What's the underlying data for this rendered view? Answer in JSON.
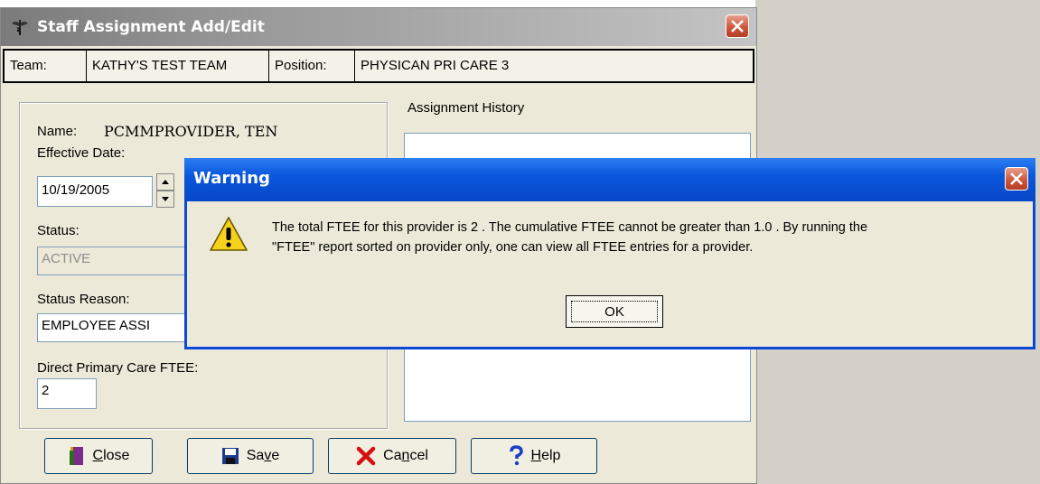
{
  "window": {
    "title": "Staff Assignment Add/Edit",
    "team_label": "Team:",
    "team_value": "KATHY'S TEST TEAM",
    "position_label": "Position:",
    "position_value": "PHYSICAN PRI CARE 3"
  },
  "form": {
    "name_label": "Name:",
    "name_value": "PCMMPROVIDER, TEN",
    "effective_date_label": "Effective Date:",
    "effective_date_value": "10/19/2005",
    "status_label": "Status:",
    "status_value": "ACTIVE",
    "status_reason_label": "Status Reason:",
    "status_reason_value": "EMPLOYEE ASSI",
    "ftee_label": "Direct Primary Care FTEE:",
    "ftee_value": "2"
  },
  "history": {
    "label": "Assignment History"
  },
  "buttons": {
    "close": {
      "pre": "",
      "u": "C",
      "post": "lose"
    },
    "save": {
      "pre": "Sa",
      "u": "v",
      "post": "e"
    },
    "cancel": {
      "pre": "Ca",
      "u": "n",
      "post": "cel"
    },
    "help": {
      "pre": "",
      "u": "H",
      "post": "elp"
    }
  },
  "warning": {
    "title": "Warning",
    "message_line1": "The total FTEE for this provider is 2 . The cumulative FTEE cannot be greater than 1.0 . By running the",
    "message_line2": "\"FTEE\" report sorted on provider only, one can view all FTEE entries for a provider.",
    "ok_label": "OK"
  },
  "colors": {
    "dialog_title": "#0b57dc",
    "close_button": "#d0563c",
    "window_bg": "#ece9d8"
  },
  "icons": [
    "caduceus-icon",
    "close-icon",
    "door-exit-icon",
    "floppy-disk-icon",
    "red-x-icon",
    "question-mark-icon",
    "warning-triangle-icon"
  ]
}
